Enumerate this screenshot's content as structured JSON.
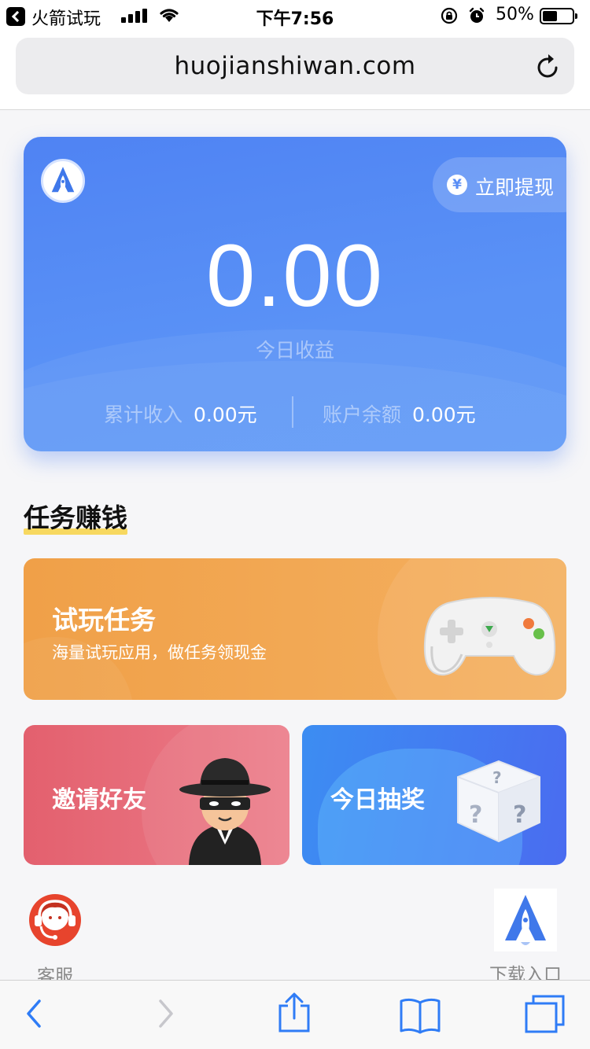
{
  "status_bar": {
    "back_app": "火箭试玩",
    "time": "下午7:56",
    "battery": "50%",
    "battery_level": 0.5
  },
  "browser": {
    "url": "huojianshiwan.com"
  },
  "balance_card": {
    "withdraw_label": "立即提现",
    "yen_symbol": "¥",
    "amount": "0.00",
    "amount_label": "今日收益",
    "total_label": "累计收入",
    "total_value": "0.00元",
    "balance_label": "账户余额",
    "balance_value": "0.00元"
  },
  "section": {
    "title": "任务赚钱"
  },
  "tasks": {
    "trial": {
      "title": "试玩任务",
      "subtitle": "海量试玩应用，做任务领现金"
    },
    "invite": {
      "title": "邀请好友"
    },
    "lottery": {
      "title": "今日抽奖"
    }
  },
  "bottom_links": {
    "service_label": "客服",
    "download_label": "下载入口"
  },
  "colors": {
    "card_blue": "#5a8ef5",
    "trial_orange": "#f0a048",
    "invite_red": "#e3606e",
    "lottery_blue": "#4a6cf0",
    "ios_blue": "#2f7cf6"
  }
}
